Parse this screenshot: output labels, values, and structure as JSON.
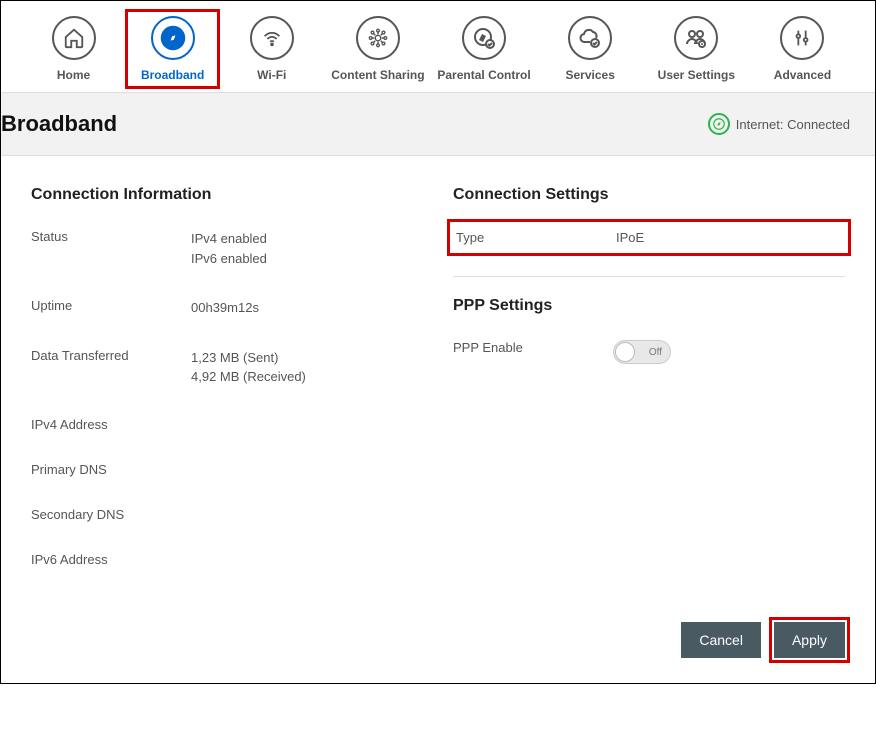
{
  "nav": {
    "items": [
      {
        "label": "Home",
        "icon": "home-icon"
      },
      {
        "label": "Broadband",
        "icon": "compass-icon"
      },
      {
        "label": "Wi-Fi",
        "icon": "wifi-icon"
      },
      {
        "label": "Content Sharing",
        "icon": "share-icon"
      },
      {
        "label": "Parental Control",
        "icon": "parental-icon"
      },
      {
        "label": "Services",
        "icon": "cloud-check-icon"
      },
      {
        "label": "User Settings",
        "icon": "users-icon"
      },
      {
        "label": "Advanced",
        "icon": "tools-icon"
      }
    ]
  },
  "header": {
    "title": "Broadband",
    "status_text": "Internet: Connected"
  },
  "connection_info": {
    "title": "Connection Information",
    "status_label": "Status",
    "status_value_line1": "IPv4 enabled",
    "status_value_line2": "IPv6 enabled",
    "uptime_label": "Uptime",
    "uptime_value": "00h39m12s",
    "data_label": "Data Transferred",
    "data_value_line1": "1,23 MB (Sent)",
    "data_value_line2": "4,92 MB (Received)",
    "ipv4_label": "IPv4 Address",
    "primary_dns_label": "Primary DNS",
    "secondary_dns_label": "Secondary DNS",
    "ipv6_label": "IPv6 Address"
  },
  "connection_settings": {
    "title": "Connection Settings",
    "type_label": "Type",
    "type_value": "IPoE"
  },
  "ppp_settings": {
    "title": "PPP Settings",
    "enable_label": "PPP Enable",
    "toggle_state": "Off"
  },
  "buttons": {
    "cancel": "Cancel",
    "apply": "Apply"
  }
}
